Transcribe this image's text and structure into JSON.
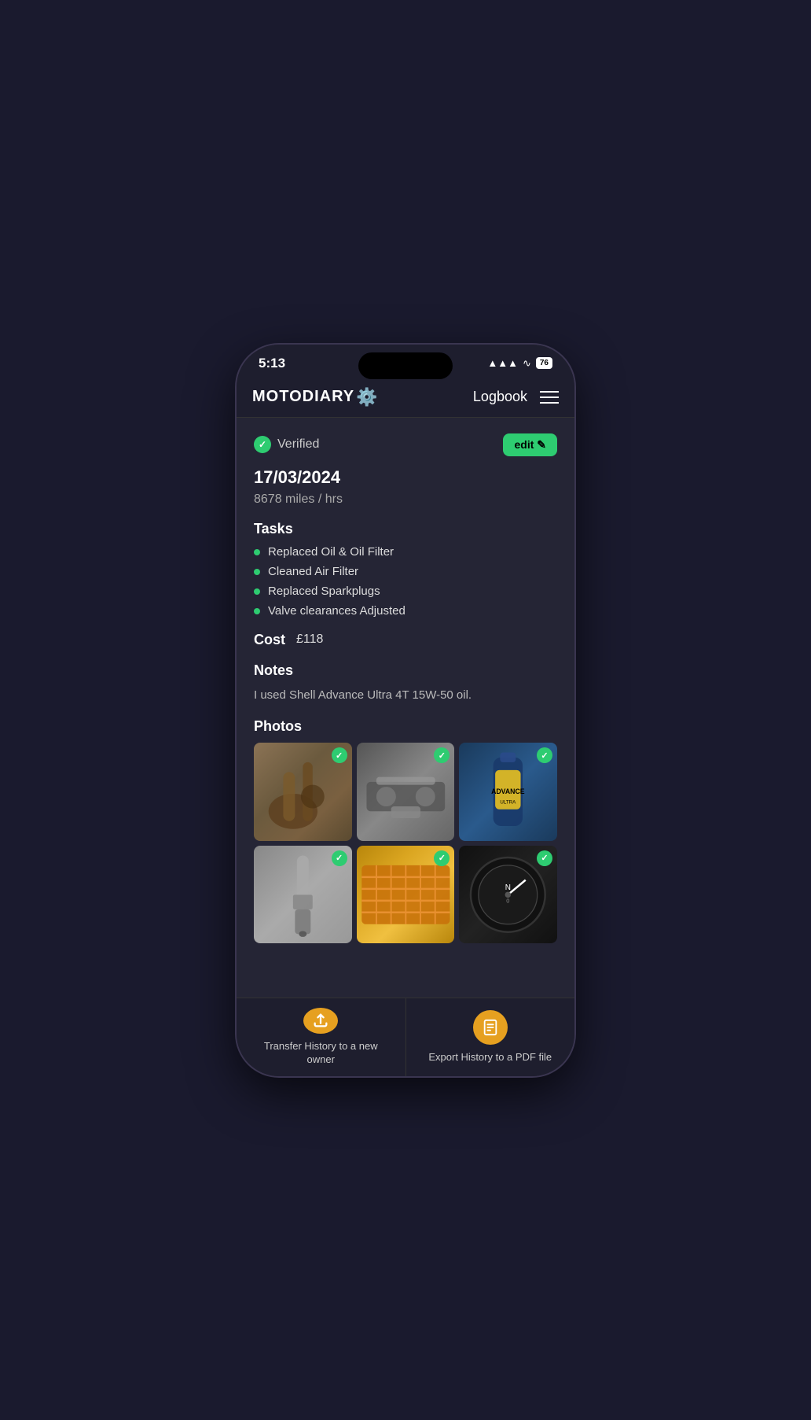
{
  "statusBar": {
    "time": "5:13",
    "signal": "▲▲▲▲",
    "wifi": "WiFi",
    "battery": "76"
  },
  "header": {
    "appName": "MOTODIARY",
    "gearEmoji": "⚙️",
    "logbook": "Logbook"
  },
  "entry": {
    "verifiedLabel": "Verified",
    "editLabel": "edit ✎",
    "date": "17/03/2024",
    "mileage": "8678 miles / hrs",
    "tasksTitle": "Tasks",
    "tasks": [
      "Replaced Oil & Oil Filter",
      "Cleaned Air Filter",
      "Replaced Sparkplugs",
      "Valve clearances Adjusted"
    ],
    "costTitle": "Cost",
    "costValue": "£118",
    "notesTitle": "Notes",
    "notesText": "I used Shell Advance Ultra 4T 15W-50 oil.",
    "photosTitle": "Photos"
  },
  "bottomBar": {
    "transferIcon": "↑",
    "transferLabel": "Transfer History to a new owner",
    "exportIcon": "📄",
    "exportLabel": "Export History to a PDF file"
  }
}
